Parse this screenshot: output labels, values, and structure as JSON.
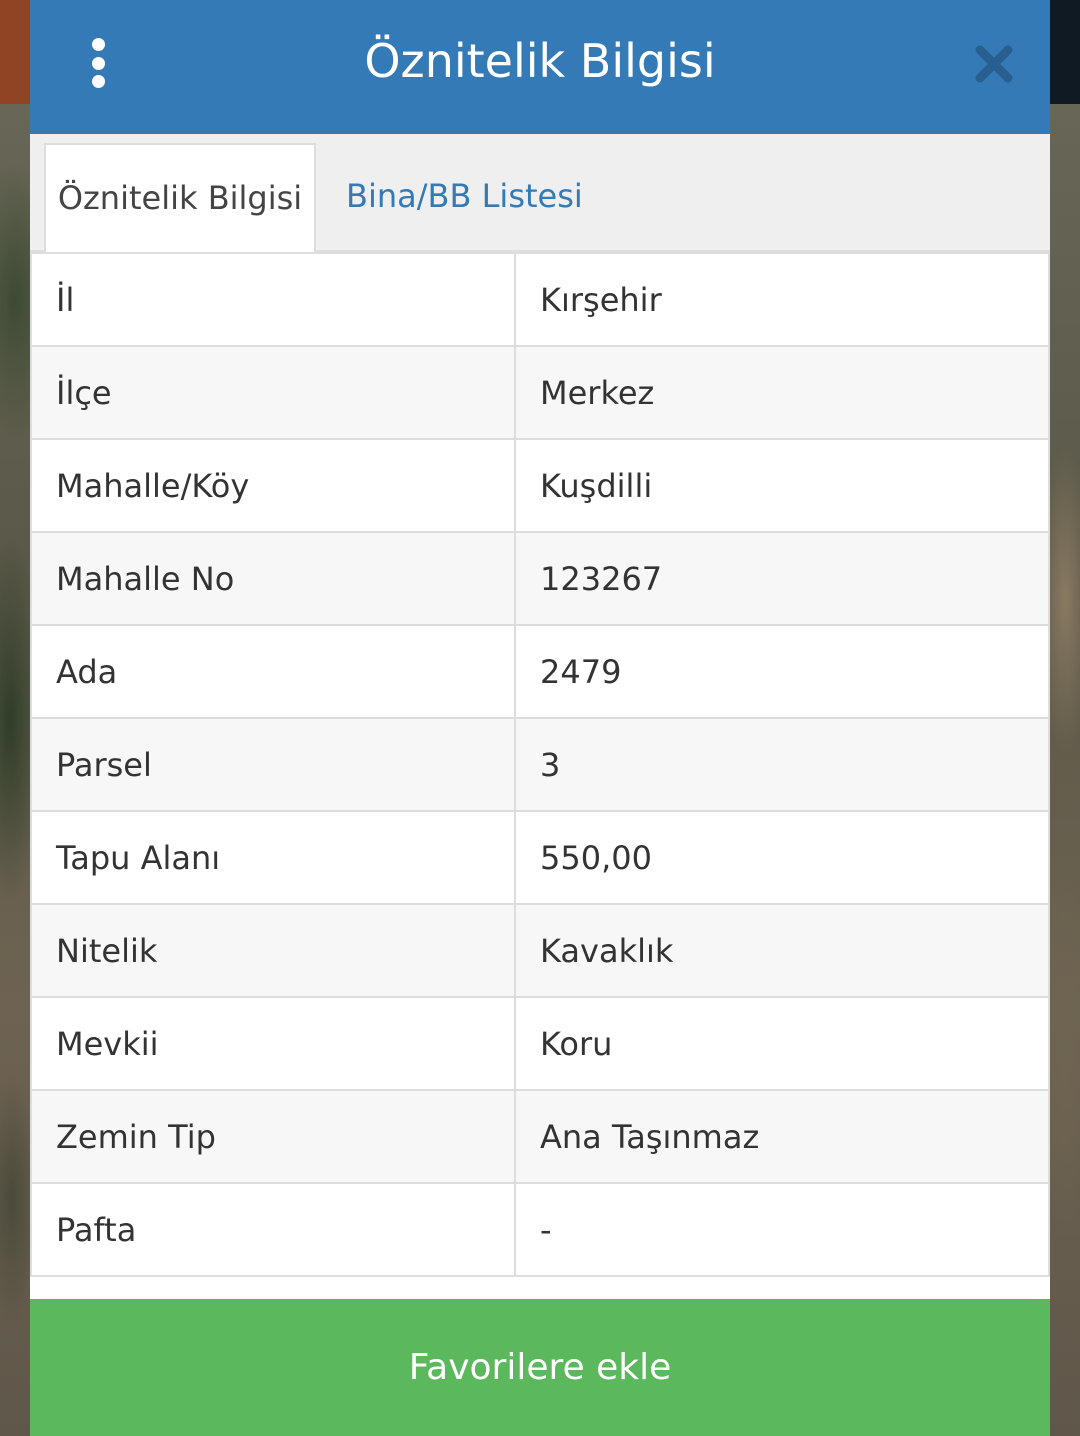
{
  "header": {
    "title": "Öznitelik Bilgisi",
    "menu_icon": "more-vertical-icon",
    "close_icon": "close-icon"
  },
  "tabs": [
    {
      "label": "Öznitelik Bilgisi",
      "active": true
    },
    {
      "label": "Bina/BB Listesi",
      "active": false
    }
  ],
  "attributes": [
    {
      "key": "İl",
      "value": "Kırşehir"
    },
    {
      "key": "İlçe",
      "value": "Merkez"
    },
    {
      "key": "Mahalle/Köy",
      "value": "Kuşdilli"
    },
    {
      "key": "Mahalle No",
      "value": "123267"
    },
    {
      "key": "Ada",
      "value": "2479"
    },
    {
      "key": "Parsel",
      "value": "3"
    },
    {
      "key": "Tapu Alanı",
      "value": "550,00"
    },
    {
      "key": "Nitelik",
      "value": "Kavaklık"
    },
    {
      "key": "Mevkii",
      "value": "Koru"
    },
    {
      "key": "Zemin Tip",
      "value": "Ana Taşınmaz"
    },
    {
      "key": "Pafta",
      "value": "-"
    }
  ],
  "footer": {
    "favorite_label": "Favorilere ekle"
  },
  "colors": {
    "header": "#337ab7",
    "favorite_button": "#5cb85c",
    "tab_link": "#337ab7"
  }
}
